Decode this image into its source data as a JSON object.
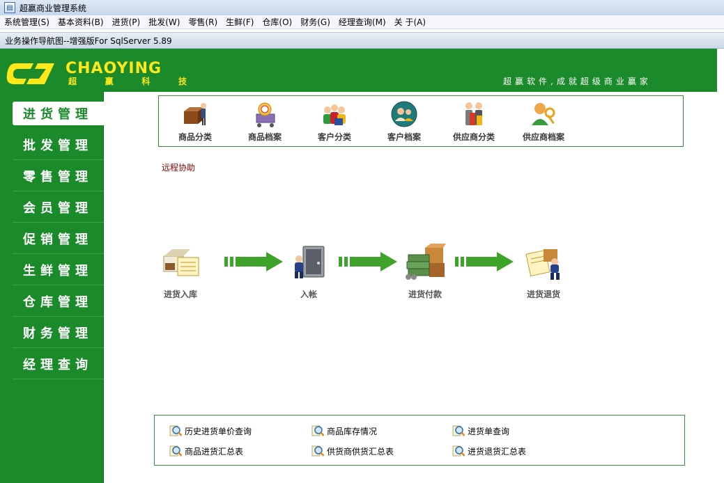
{
  "window": {
    "title": "超赢商业管理系统"
  },
  "menu": [
    "系统管理(S)",
    "基本资料(B)",
    "进货(P)",
    "批发(W)",
    "零售(R)",
    "生鲜(F)",
    "仓库(O)",
    "财务(G)",
    "经理查询(M)",
    "关 于(A)"
  ],
  "child_window": {
    "title": "业务操作导航图--增强版For SqlServer 5.89"
  },
  "header": {
    "brand": "CHAOYING",
    "brand_sub": [
      "超",
      "赢",
      "科",
      "技"
    ],
    "slogan": "超赢软件,成就超级商业赢家"
  },
  "sidebar": {
    "items": [
      "进货管理",
      "批发管理",
      "零售管理",
      "会员管理",
      "促销管理",
      "生鲜管理",
      "仓库管理",
      "财务管理",
      "经理查询"
    ],
    "active_index": 0
  },
  "toolbar": {
    "items": [
      {
        "label": "商品分类",
        "icon": "goods-category-icon"
      },
      {
        "label": "商品档案",
        "icon": "goods-archive-icon"
      },
      {
        "label": "客户分类",
        "icon": "customer-category-icon"
      },
      {
        "label": "客户档案",
        "icon": "customer-archive-icon"
      },
      {
        "label": "供应商分类",
        "icon": "supplier-category-icon"
      },
      {
        "label": "供应商档案",
        "icon": "supplier-archive-icon"
      }
    ]
  },
  "remote_help": "远程协助",
  "flow": {
    "steps": [
      {
        "label": "进货入库",
        "icon": "stock-in-icon"
      },
      {
        "label": "入帐",
        "icon": "bookkeeping-icon"
      },
      {
        "label": "进货付款",
        "icon": "payment-icon"
      },
      {
        "label": "进货退货",
        "icon": "return-goods-icon"
      }
    ]
  },
  "reports": {
    "items": [
      "历史进货单价查询",
      "商品库存情况",
      "进货单查询",
      "商品进货汇总表",
      "供货商供货汇总表",
      "进货退货汇总表"
    ]
  },
  "colors": {
    "brand_green": "#1b8a2a",
    "logo_yellow": "#ffe81a",
    "arrow_green": "#3fa32b",
    "box_border": "#3c8b3c",
    "help_text": "#8b0000"
  }
}
